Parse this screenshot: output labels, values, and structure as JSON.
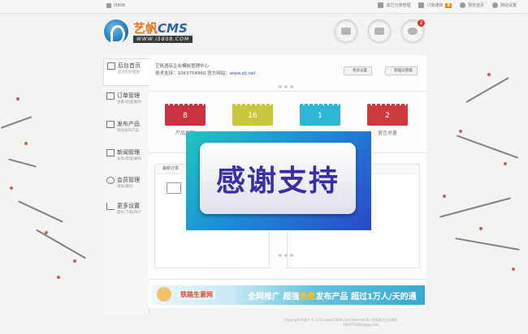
{
  "topbar": {
    "username": "i5808",
    "links": [
      {
        "icon": "doc-icon",
        "label": "其它分类管理"
      },
      {
        "icon": "order-icon",
        "label": "订单通知",
        "badge": "8"
      },
      {
        "icon": "cloud-icon",
        "label": "预览首页"
      },
      {
        "icon": "gear-icon",
        "label": "网站设置"
      }
    ]
  },
  "logo": {
    "name_cn": "艺帆",
    "name_en": "CMS",
    "url": "WWW.i5808.COM"
  },
  "header_icons": {
    "notification_count": "2"
  },
  "sidebar": {
    "items": [
      {
        "title": "后台首页",
        "sub": "后台综合看板"
      },
      {
        "title": "订单管理",
        "sub": "查看/处理/删除"
      },
      {
        "title": "发布产品",
        "sub": "快速发布产品"
      },
      {
        "title": "新闻管理",
        "sub": "发布/管理/删除"
      },
      {
        "title": "会员管理",
        "sub": "审核/删除"
      },
      {
        "title": "更多设置",
        "sub": "图片/下载/简介"
      }
    ]
  },
  "main": {
    "welcome": "艺帆酒店企业模板管理中心",
    "support": "技术支持：1063754960 官方网站：",
    "site": "www.xlj.net",
    "btn_more": "更多设置",
    "btn_admin": "管理员管理",
    "cards": [
      {
        "value": "8",
        "label": "产品总数",
        "color": "#c8333f"
      },
      {
        "value": "16",
        "label": "",
        "color": "#c9c640"
      },
      {
        "value": "1",
        "label": "",
        "color": "#2eb6d6"
      },
      {
        "value": "2",
        "label": "留言总量",
        "color": "#cc3b3d"
      }
    ],
    "panel_title": "最新订单"
  },
  "banner": {
    "left": "铁路生意网",
    "right_prefix": "全网推广  超强",
    "right_highlight": "免费",
    "right_suffix": "发布产品  超过1万人/天的通"
  },
  "footer": {
    "line1": "Copyright Right © 2012 www.i5808.com Powered By 艺帆酒店企业模板",
    "line2": "1063754960@qq.com"
  },
  "overlay": {
    "text": "感谢支持"
  }
}
